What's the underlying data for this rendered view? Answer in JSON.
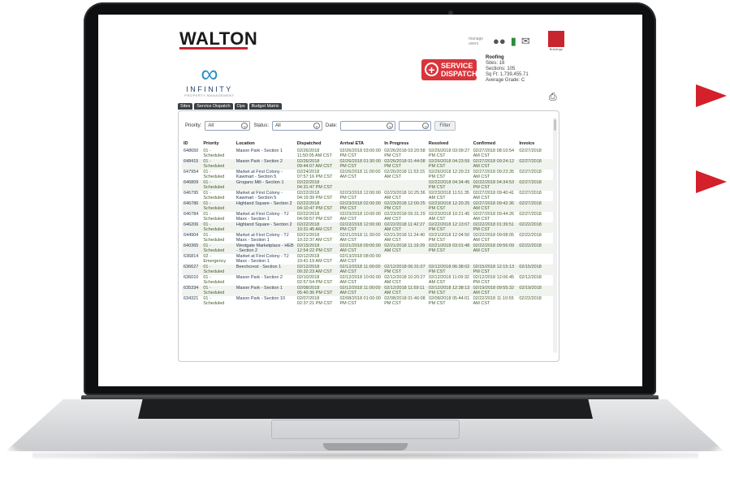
{
  "brand": {
    "name": "WALTON",
    "accent": "#c8262f"
  },
  "header_icons": {
    "manage_label": "manage users",
    "items": [
      "users-icon",
      "document-icon",
      "mail-icon",
      "building-icon"
    ],
    "building_label": "Buildings"
  },
  "client": {
    "name": "INFINITY",
    "tagline": "PROPERTY MANAGEMENT"
  },
  "service_dispatch": {
    "line1": "SERVICE",
    "line2": "DISPATCH"
  },
  "summary": {
    "title": "Roofing",
    "sites": "Sites: 18",
    "sections": "Sections: 105",
    "sqft": "Sq Ft: 1,739,455.71",
    "grade": "Average Grade: C"
  },
  "tabs": [
    "Sites",
    "Service Dispatch",
    "Ops",
    "Budget Matrix"
  ],
  "filters": {
    "priority_label": "Priority:",
    "priority_value": "All",
    "status_label": "Status:",
    "status_value": "All",
    "date_label": "Date:",
    "date_from": "",
    "date_to": "",
    "filter_button": "Filter"
  },
  "table": {
    "columns": [
      "ID",
      "Priority",
      "Location",
      "Dispatched",
      "Arrival ETA",
      "In Progress",
      "Resolved",
      "Confirmed",
      "Invoice"
    ],
    "rows": [
      [
        "648650",
        "01 - Scheduled",
        "Mason Park - Section 1",
        "02/26/2018 11:50:05 AM CST",
        "02/26/2018 03:00:00 PM CST",
        "02/26/2018 03:20:58 PM CST",
        "02/26/2018 03:09:27 PM CST",
        "02/27/2018 08:10:54 AM CST",
        "02/27/2018"
      ],
      [
        "648415",
        "01 - Scheduled",
        "Mason Park - Section 2",
        "02/26/2018 09:44:07 AM CST",
        "02/26/2018 01:30:00 PM CST",
        "02/26/2018 01:44:08 PM CST",
        "02/26/2018 04:23:59 PM CST",
        "02/27/2018 09:24:12 AM CST",
        "02/27/2018"
      ],
      [
        "647954",
        "01 - Scheduled",
        "Market at First Colony - Kawmart - Section 5",
        "02/24/2018 07:57:16 PM CST",
        "02/26/2018 11:00:00 AM CST",
        "02/26/2018 11:53:15 AM CST",
        "02/26/2018 12:29:23 PM CST",
        "02/27/2018 09:23:35 AM CST",
        "02/27/2018"
      ],
      [
        "646809",
        "01 - Scheduled",
        "Grogans Mill - Section 1",
        "02/22/2018 04:31:47 PM CST",
        "",
        "",
        "02/22/2018 04:34:45 PM CST",
        "02/22/2018 04:34:53 PM CST",
        "02/27/2018"
      ],
      [
        "646795",
        "01 - Scheduled",
        "Market at First Colony - Kawmart - Section 5",
        "02/22/2018 04:19:39 PM CST",
        "02/23/2018 12:00:00 PM CST",
        "02/23/2018 10:25:36 AM CST",
        "02/23/2018 11:51:35 AM CST",
        "02/27/2018 09:40:41 AM CST",
        "02/27/2018"
      ],
      [
        "646786",
        "01 - Scheduled",
        "Highland Square - Section 2",
        "02/22/2018 04:10:47 PM CST",
        "02/23/2018 02:00:00 PM CST",
        "02/23/2018 12:00:25 PM CST",
        "02/23/2018 12:20:25 PM CST",
        "02/27/2018 09:42:36 AM CST",
        "02/27/2018"
      ],
      [
        "646784",
        "01 - Scheduled",
        "Market at First Colony - TJ Maxx - Section 1",
        "02/22/2018 04:09:57 PM CST",
        "02/23/2018 10:00:00 AM CST",
        "02/23/2018 09:31:29 AM CST",
        "02/23/2018 10:21:45 AM CST",
        "02/27/2018 09:44:26 AM CST",
        "02/27/2018"
      ],
      [
        "646206",
        "01 - Scheduled",
        "Highland Square - Section 2",
        "02/22/2018 10:31:45 AM CST",
        "02/22/2018 12:00:00 PM CST",
        "02/22/2018 11:42:27 AM CST",
        "02/22/2018 12:13:07 PM CST",
        "02/22/2018 01:39:51 PM CST",
        "02/22/2018"
      ],
      [
        "644904",
        "01 - Scheduled",
        "Market at First Colony - TJ Maxx - Section 1",
        "02/21/2018 10:22:37 AM CST",
        "02/21/2018 11:30:00 AM CST",
        "02/21/2018 11:24:40 AM CST",
        "02/21/2018 12:04:50 PM CST",
        "02/22/2018 09:08:05 AM CST",
        "02/22/2018"
      ],
      [
        "640365",
        "01 - Scheduled",
        "Westgate Marketplace - HEB - Section 2",
        "02/15/2018 12:54:22 PM CST",
        "02/21/2018 09:00:00 AM CST",
        "02/21/2018 11:19:29 AM CST",
        "02/21/2018 03:01:48 PM CST",
        "02/22/2018 09:56:09 AM CST",
        "02/22/2018"
      ],
      [
        "636814",
        "02 - Emergency",
        "Market at First Colony - TJ Maxx - Section 1",
        "02/12/2018 10:41:19 AM CST",
        "02/13/2018 08:00:00 AM CST",
        "",
        "",
        "",
        ""
      ],
      [
        "636627",
        "01 - Scheduled",
        "Beechcrest - Section 1",
        "02/12/2018 09:32:23 AM CST",
        "02/12/2018 11:00:00 AM CST",
        "02/12/2018 06:31:07 PM CST",
        "02/12/2018 06:38:02 PM CST",
        "02/15/2018 12:15:13 PM CST",
        "02/15/2018"
      ],
      [
        "636010",
        "01 - Scheduled",
        "Mason Park - Section 2",
        "02/10/2018 02:57:54 PM CST",
        "02/12/2018 10:00:00 AM CST",
        "02/12/2018 10:20:27 AM CST",
        "02/12/2018 11:09:32 AM CST",
        "02/12/2018 12:06:45 PM CST",
        "02/12/2018"
      ],
      [
        "635334",
        "01 - Scheduled",
        "Mason Park - Section 1",
        "02/08/2018 05:40:36 PM CST",
        "02/12/2018 11:00:00 AM CST",
        "02/12/2018 11:59:11 AM CST",
        "02/12/2018 12:38:13 PM CST",
        "02/19/2018 09:55:32 AM CST",
        "02/19/2018"
      ],
      [
        "634321",
        "01 - Scheduled",
        "Mason Park - Section 10",
        "02/07/2018 02:37:21 PM CST",
        "02/08/2018 01:00:00 PM CST",
        "02/08/2018 01:46:08 PM CST",
        "02/08/2018 05:44:01 PM CST",
        "02/22/2018 11:10:55 AM CST",
        "02/22/2018"
      ]
    ]
  }
}
